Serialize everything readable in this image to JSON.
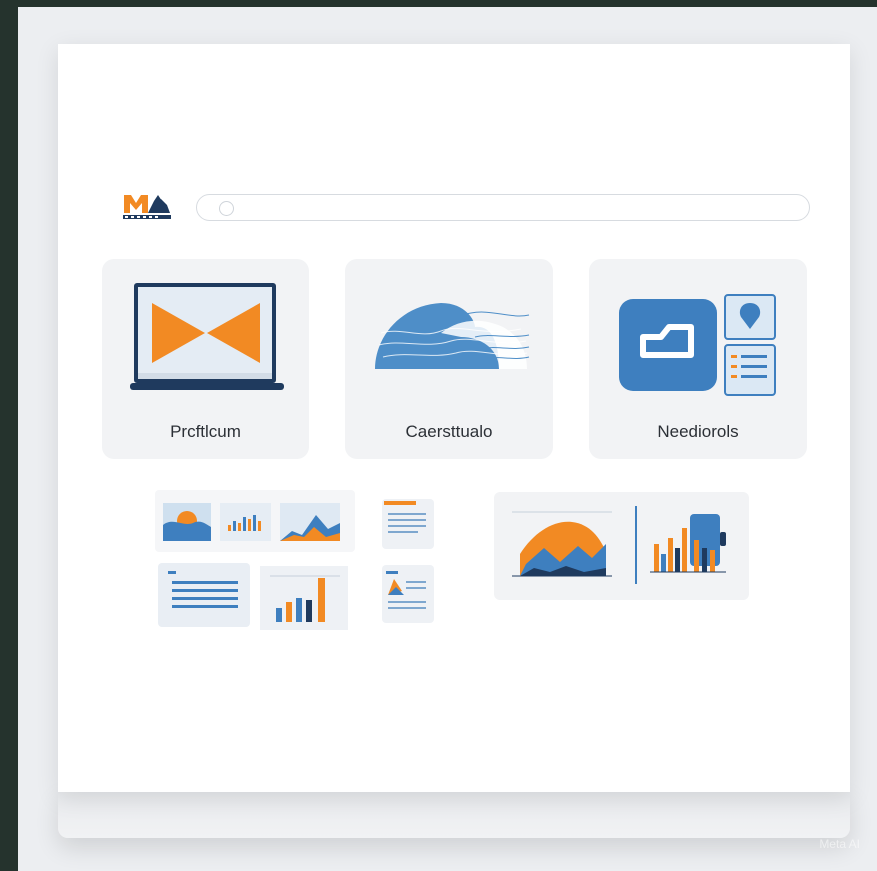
{
  "tiles": [
    {
      "label": "Prcftlcum",
      "icon": "laptop-icon"
    },
    {
      "label": "Caersttualo",
      "icon": "landscape-icon"
    },
    {
      "label": "Neediorols",
      "icon": "app-folder-icon"
    }
  ],
  "search": {
    "placeholder": ""
  },
  "watermark": "Meta AI",
  "colors": {
    "accent_orange": "#f28a23",
    "accent_blue": "#3e7fbf",
    "dark_navy": "#1f3a5e",
    "tile_bg": "#f2f3f5"
  }
}
